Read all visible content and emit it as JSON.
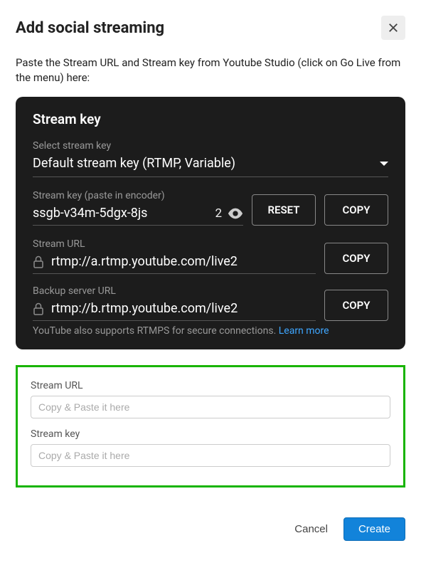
{
  "modal": {
    "title": "Add social streaming",
    "instruction": "Paste the Stream URL and Stream key from Youtube Studio (click on Go Live from the menu) here:"
  },
  "panel": {
    "title": "Stream key",
    "select_label": "Select stream key",
    "select_value": "Default stream key (RTMP, Variable)",
    "key_label": "Stream key (paste in encoder)",
    "key_value": "ssgb-v34m-5dgx-8js",
    "key_suffix": "2",
    "reset_label": "RESET",
    "copy_label": "COPY",
    "url_label": "Stream URL",
    "url_value": "rtmp://a.rtmp.youtube.com/live2",
    "backup_label": "Backup server URL",
    "backup_value": "rtmp://b.rtmp.youtube.com/live2",
    "footer_text": "YouTube also supports RTMPS for secure connections. ",
    "footer_link": "Learn more"
  },
  "form": {
    "url_label": "Stream URL",
    "url_placeholder": "Copy & Paste it here",
    "key_label": "Stream key",
    "key_placeholder": "Copy & Paste it here"
  },
  "footer": {
    "cancel": "Cancel",
    "create": "Create"
  }
}
